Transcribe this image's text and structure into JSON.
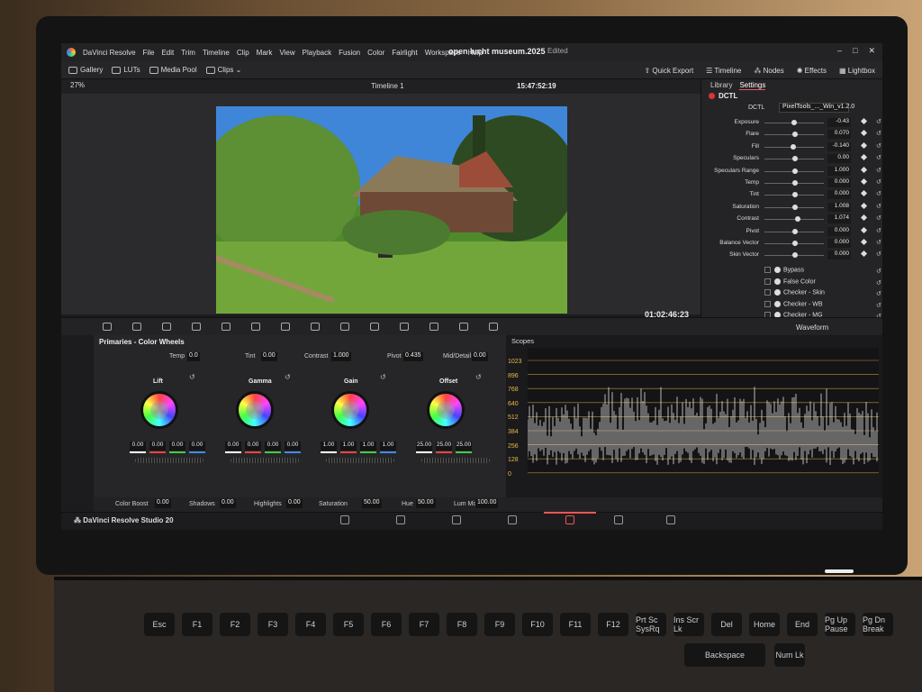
{
  "app": {
    "name": "DaVinci Resolve",
    "menus": [
      "File",
      "Edit",
      "Trim",
      "Timeline",
      "Clip",
      "Mark",
      "View",
      "Playback",
      "Fusion",
      "Color",
      "Fairlight",
      "Workspace",
      "Help"
    ],
    "project_title": "open lucht museum.2025",
    "status": "Edited",
    "brand_footer": "DaVinci Resolve Studio 20"
  },
  "toolbar": {
    "gallery": "Gallery",
    "luts": "LUTs",
    "media_pool": "Media Pool",
    "clips": "Clips",
    "quick_export": "Quick Export",
    "timeline": "Timeline",
    "nodes": "Nodes",
    "effects": "Effects",
    "lightbox": "Lightbox"
  },
  "viewer": {
    "zoom": "27%",
    "timeline_name": "Timeline 1",
    "timecode_top": "15:47:52:19",
    "timecode_bottom": "01:02:46;23"
  },
  "effects_panel": {
    "tabs": [
      "Library",
      "Settings"
    ],
    "active_tab": "Settings",
    "header": "DCTL",
    "dctl_label": "DCTL",
    "dctl_selected": "PixelTools_..._Win_v1.2.0",
    "params": [
      {
        "name": "Exposure",
        "value": "-0.43",
        "pos": 0.48
      },
      {
        "name": "Flare",
        "value": "0.070",
        "pos": 0.5
      },
      {
        "name": "Fill",
        "value": "-0.140",
        "pos": 0.46
      },
      {
        "name": "Speculars",
        "value": "0.00",
        "pos": 0.5
      },
      {
        "name": "Speculars Range",
        "value": "1.000",
        "pos": 0.5
      },
      {
        "name": "Temp",
        "value": "0.000",
        "pos": 0.5
      },
      {
        "name": "Tint",
        "value": "0.000",
        "pos": 0.5
      },
      {
        "name": "Saturation",
        "value": "1.008",
        "pos": 0.5
      },
      {
        "name": "Contrast",
        "value": "1.074",
        "pos": 0.55
      },
      {
        "name": "Pivot",
        "value": "0.000",
        "pos": 0.5
      },
      {
        "name": "Balance Vector",
        "value": "0.000",
        "pos": 0.5
      },
      {
        "name": "Skin Vector",
        "value": "0.000",
        "pos": 0.5
      }
    ],
    "checks": [
      "Bypass",
      "False Color",
      "Checker - Skin",
      "Checker - WB",
      "Checker - MG"
    ]
  },
  "color_page": {
    "scope_mode": "Waveform",
    "primaries_title": "Primaries - Color Wheels",
    "top_controls": [
      {
        "label": "Temp",
        "value": "0.0"
      },
      {
        "label": "Tint",
        "value": "0.00"
      },
      {
        "label": "Contrast",
        "value": "1.000"
      },
      {
        "label": "Pivot",
        "value": "0.435"
      },
      {
        "label": "Mid/Detail",
        "value": "0.00"
      }
    ],
    "wheels": [
      {
        "name": "Lift",
        "values": [
          "0.00",
          "0.00",
          "0.00",
          "0.00"
        ]
      },
      {
        "name": "Gamma",
        "values": [
          "0.00",
          "0.00",
          "0.00",
          "0.00"
        ]
      },
      {
        "name": "Gain",
        "values": [
          "1.00",
          "1.00",
          "1.00",
          "1.00"
        ]
      },
      {
        "name": "Offset",
        "values": [
          "25.00",
          "25.00",
          "25.00"
        ]
      }
    ],
    "bottom_controls": [
      {
        "label": "Color Boost",
        "value": "0.00"
      },
      {
        "label": "Shadows",
        "value": "0.00"
      },
      {
        "label": "Highlights",
        "value": "0.00"
      },
      {
        "label": "Saturation",
        "value": "50.00"
      },
      {
        "label": "Hue",
        "value": "50.00"
      },
      {
        "label": "Lum Mix",
        "value": "100.00"
      }
    ],
    "scopes_title": "Scopes",
    "scope_scale": [
      "1023",
      "896",
      "768",
      "640",
      "512",
      "384",
      "256",
      "128",
      "0"
    ]
  },
  "keyboard": {
    "keys": [
      "Esc",
      "F1",
      "F2",
      "F3",
      "F4",
      "F5",
      "F6",
      "F7",
      "F8",
      "F9",
      "F10",
      "F11",
      "F12",
      "Prt Sc SysRq",
      "Ins Scr Lk",
      "Del",
      "Home",
      "End",
      "Pg Up Pause",
      "Pg Dn Break",
      "Backspace",
      "Num Lk"
    ]
  },
  "colors": {
    "accent": "#e55555",
    "scope_label": "#e8b84a",
    "panel": "#262628"
  }
}
